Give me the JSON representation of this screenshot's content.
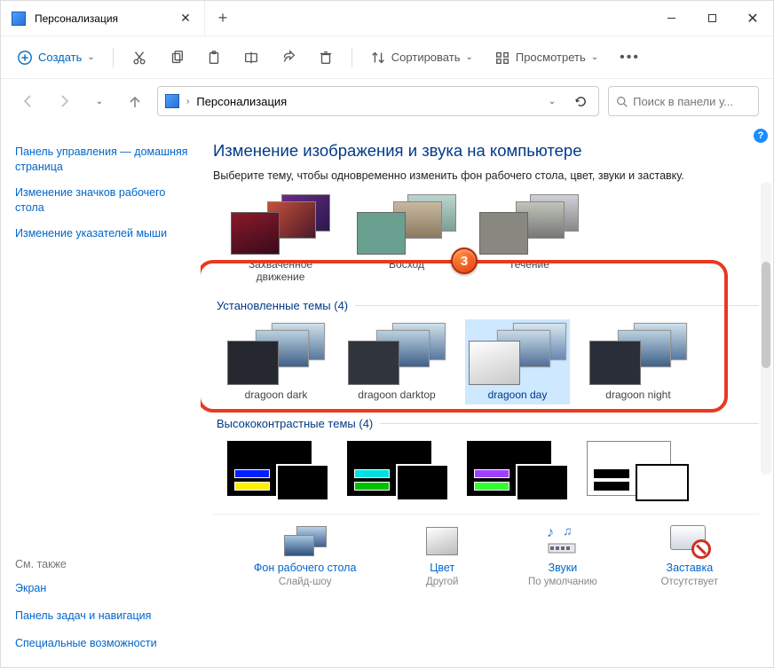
{
  "tab": {
    "title": "Персонализация"
  },
  "toolbar": {
    "create": "Создать",
    "sort": "Сортировать",
    "view": "Просмотреть"
  },
  "address": {
    "path": "Персонализация"
  },
  "search": {
    "placeholder": "Поиск в панели у..."
  },
  "sidebar": {
    "items": [
      "Панель управления — домашняя страница",
      "Изменение значков рабочего стола",
      "Изменение указателей мыши"
    ],
    "footer_header": "См. также",
    "footer": [
      "Экран",
      "Панель задач и навигация",
      "Специальные возможности"
    ]
  },
  "main": {
    "title": "Изменение изображения и звука на компьютере",
    "subtitle": "Выберите тему, чтобы одновременно изменить фон рабочего стола, цвет, звуки и заставку.",
    "top_themes": [
      "Захваченное движение",
      "Восход",
      "Течение"
    ],
    "installed_header": "Установленные темы (4)",
    "installed": [
      "dragoon dark",
      "dragoon darktop",
      "dragoon day",
      "dragoon night"
    ],
    "hc_header": "Высококонтрастные темы (4)"
  },
  "bottom": {
    "items": [
      {
        "title": "Фон рабочего стола",
        "sub": "Слайд-шоу"
      },
      {
        "title": "Цвет",
        "sub": "Другой"
      },
      {
        "title": "Звуки",
        "sub": "По умолчанию"
      },
      {
        "title": "Заставка",
        "sub": "Отсутствует"
      }
    ]
  },
  "callout": "3"
}
